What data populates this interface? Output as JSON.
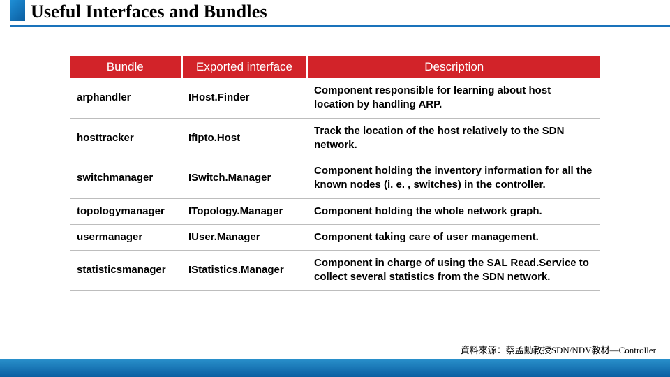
{
  "title": "Useful Interfaces and Bundles",
  "columns": [
    "Bundle",
    "Exported interface",
    "Description"
  ],
  "rows": [
    {
      "bundle": "arphandler",
      "iface": "IHost.Finder",
      "desc": "Component responsible for learning about host location by handling ARP."
    },
    {
      "bundle": "hosttracker",
      "iface": "IfIpto.Host",
      "desc": "Track the location of the host relatively to the SDN network."
    },
    {
      "bundle": "switchmanager",
      "iface": "ISwitch.Manager",
      "desc": "Component holding the inventory information for all the known nodes (i. e. , switches) in the controller."
    },
    {
      "bundle": "topologymanager",
      "iface": "ITopology.Manager",
      "desc": "Component holding the whole network graph."
    },
    {
      "bundle": "usermanager",
      "iface": "IUser.Manager",
      "desc": "Component taking care of user management."
    },
    {
      "bundle": "statisticsmanager",
      "iface": "IStatistics.Manager",
      "desc": "Component in charge of using the SAL Read.Service to collect several statistics from the SDN network."
    }
  ],
  "credit": "資料來源：蔡孟勳教授SDN/NDV教材—Controller"
}
